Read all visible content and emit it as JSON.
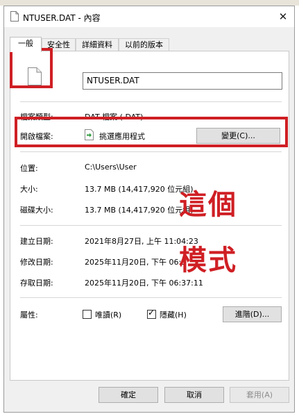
{
  "window": {
    "title": "NTUSER.DAT - 內容",
    "close_glyph": "✕"
  },
  "tabs": [
    "一般",
    "安全性",
    "詳細資料",
    "以前的版本"
  ],
  "file": {
    "name": "NTUSER.DAT"
  },
  "properties": {
    "type_label": "檔案類型:",
    "type_value": "DAT 檔案 (.DAT)",
    "opens_label": "開啟檔案:",
    "opens_value": "挑選應用程式",
    "change_button": "變更(C)...",
    "location_label": "位置:",
    "location_value": "C:\\Users\\User",
    "size_label": "大小:",
    "size_value": "13.7 MB (14,417,920 位元組)",
    "disk_size_label": "磁碟大小:",
    "disk_size_value": "13.7 MB (14,417,920 位元組)",
    "created_label": "建立日期:",
    "created_value": "2021年8月27日, 上午 11:04:23",
    "modified_label": "修改日期:",
    "modified_value": "2025年11月20日, 下午 06:3",
    "accessed_label": "存取日期:",
    "accessed_value": "2025年11月20日, 下午 06:37:11"
  },
  "attributes": {
    "label": "屬性:",
    "readonly_label": "唯讀(R)",
    "readonly_checked": false,
    "hidden_label": "隱藏(H)",
    "hidden_checked": true,
    "advanced_button": "進階(D)..."
  },
  "footer": {
    "ok": "確定",
    "cancel": "取消",
    "apply": "套用(A)"
  },
  "annotations": {
    "line1": "這個",
    "line2": "模式",
    "color": "#cf1f24"
  }
}
